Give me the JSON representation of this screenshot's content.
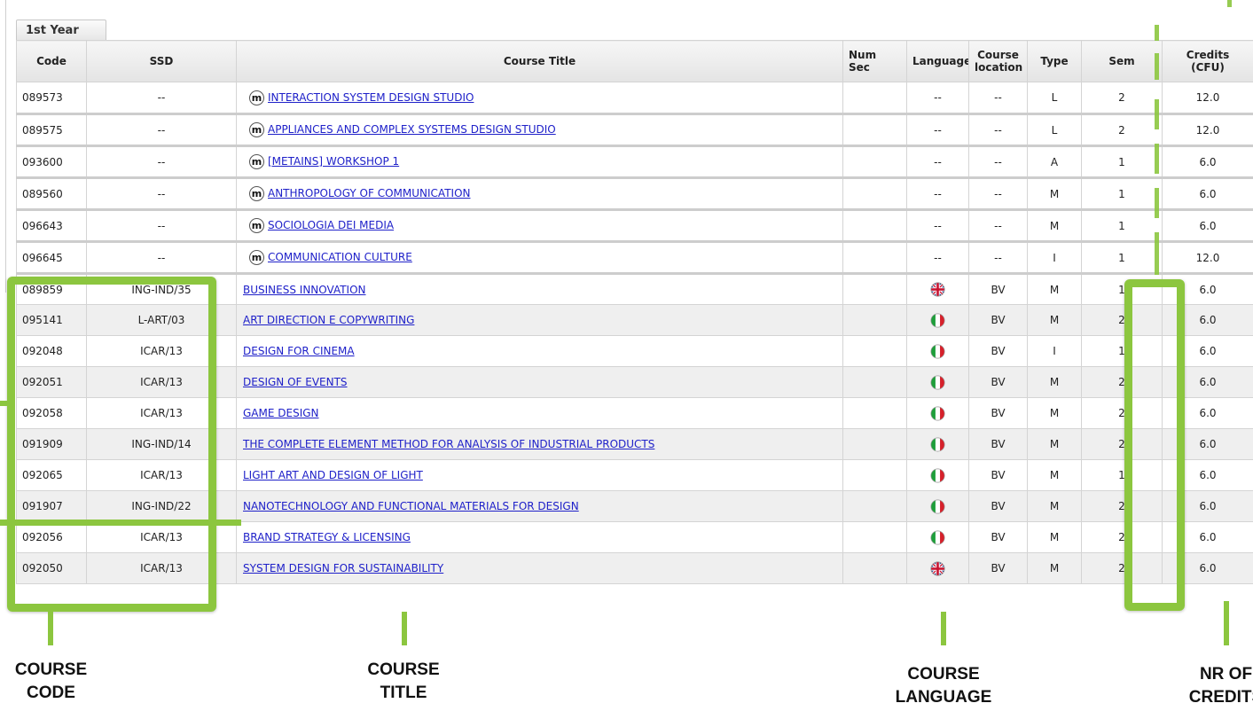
{
  "tab": {
    "label": "1st Year"
  },
  "columns": {
    "code": "Code",
    "ssd": "SSD",
    "title": "Course Title",
    "num_sec": "Num Sec",
    "language": "Language",
    "location": "Course location",
    "type": "Type",
    "sem": "Sem",
    "credits": "Credits (CFU)"
  },
  "rows": [
    {
      "code": "089573",
      "ssd": "--",
      "badge": "m",
      "title": "INTERACTION SYSTEM DESIGN STUDIO",
      "num_sec": "",
      "language": "--",
      "location": "--",
      "type": "L",
      "sem": "2",
      "credits": "12.0"
    },
    {
      "code": "089575",
      "ssd": "--",
      "badge": "m",
      "title": "APPLIANCES AND COMPLEX SYSTEMS DESIGN STUDIO",
      "num_sec": "",
      "language": "--",
      "location": "--",
      "type": "L",
      "sem": "2",
      "credits": "12.0"
    },
    {
      "code": "093600",
      "ssd": "--",
      "badge": "m",
      "title": "[METAINS] WORKSHOP 1",
      "num_sec": "",
      "language": "--",
      "location": "--",
      "type": "A",
      "sem": "1",
      "credits": "6.0"
    },
    {
      "code": "089560",
      "ssd": "--",
      "badge": "m",
      "title": "ANTHROPOLOGY OF COMMUNICATION",
      "num_sec": "",
      "language": "--",
      "location": "--",
      "type": "M",
      "sem": "1",
      "credits": "6.0"
    },
    {
      "code": "096643",
      "ssd": "--",
      "badge": "m",
      "title": "SOCIOLOGIA DEI MEDIA",
      "num_sec": "",
      "language": "--",
      "location": "--",
      "type": "M",
      "sem": "1",
      "credits": "6.0"
    },
    {
      "code": "096645",
      "ssd": "--",
      "badge": "m",
      "title": "COMMUNICATION CULTURE",
      "num_sec": "",
      "language": "--",
      "location": "--",
      "type": "I",
      "sem": "1",
      "credits": "12.0"
    },
    {
      "code": "089859",
      "ssd": "ING-IND/35",
      "badge": "",
      "title": "BUSINESS INNOVATION",
      "num_sec": "",
      "language": "uk-flag",
      "location": "BV",
      "type": "M",
      "sem": "1",
      "credits": "6.0"
    },
    {
      "code": "095141",
      "ssd": "L-ART/03",
      "badge": "",
      "title": "ART DIRECTION E COPYWRITING",
      "num_sec": "",
      "language": "it-flag",
      "location": "BV",
      "type": "M",
      "sem": "2",
      "credits": "6.0"
    },
    {
      "code": "092048",
      "ssd": "ICAR/13",
      "badge": "",
      "title": "DESIGN FOR CINEMA",
      "num_sec": "",
      "language": "it-flag",
      "location": "BV",
      "type": "I",
      "sem": "1",
      "credits": "6.0"
    },
    {
      "code": "092051",
      "ssd": "ICAR/13",
      "badge": "",
      "title": "DESIGN OF EVENTS",
      "num_sec": "",
      "language": "it-flag",
      "location": "BV",
      "type": "M",
      "sem": "2",
      "credits": "6.0"
    },
    {
      "code": "092058",
      "ssd": "ICAR/13",
      "badge": "",
      "title": "GAME DESIGN",
      "num_sec": "",
      "language": "it-flag",
      "location": "BV",
      "type": "M",
      "sem": "2",
      "credits": "6.0"
    },
    {
      "code": "091909",
      "ssd": "ING-IND/14",
      "badge": "",
      "title": "THE COMPLETE ELEMENT METHOD FOR ANALYSIS OF INDUSTRIAL PRODUCTS",
      "num_sec": "",
      "language": "it-flag",
      "location": "BV",
      "type": "M",
      "sem": "2",
      "credits": "6.0"
    },
    {
      "code": "092065",
      "ssd": "ICAR/13",
      "badge": "",
      "title": "LIGHT ART AND DESIGN OF LIGHT",
      "num_sec": "",
      "language": "it-flag",
      "location": "BV",
      "type": "M",
      "sem": "1",
      "credits": "6.0"
    },
    {
      "code": "091907",
      "ssd": "ING-IND/22",
      "badge": "",
      "title": "NANOTECHNOLOGY AND FUNCTIONAL MATERIALS FOR DESIGN",
      "num_sec": "",
      "language": "it-flag",
      "location": "BV",
      "type": "M",
      "sem": "2",
      "credits": "6.0"
    },
    {
      "code": "092056",
      "ssd": "ICAR/13",
      "badge": "",
      "title": "BRAND STRATEGY & LICENSING",
      "num_sec": "",
      "language": "it-flag",
      "location": "BV",
      "type": "M",
      "sem": "2",
      "credits": "6.0"
    },
    {
      "code": "092050",
      "ssd": "ICAR/13",
      "badge": "",
      "title": "SYSTEM DESIGN FOR SUSTAINABILITY",
      "num_sec": "",
      "language": "uk-flag",
      "location": "BV",
      "type": "M",
      "sem": "2",
      "credits": "6.0"
    }
  ],
  "callouts": {
    "code": "COURSE CODE",
    "title": "COURSE TITLE",
    "language": "COURSE LANGUAGE",
    "credits": "NR OF CREDITS"
  },
  "colors": {
    "highlight": "#8cc63f",
    "link": "#1f21c9",
    "row_alt": "#efefef"
  }
}
